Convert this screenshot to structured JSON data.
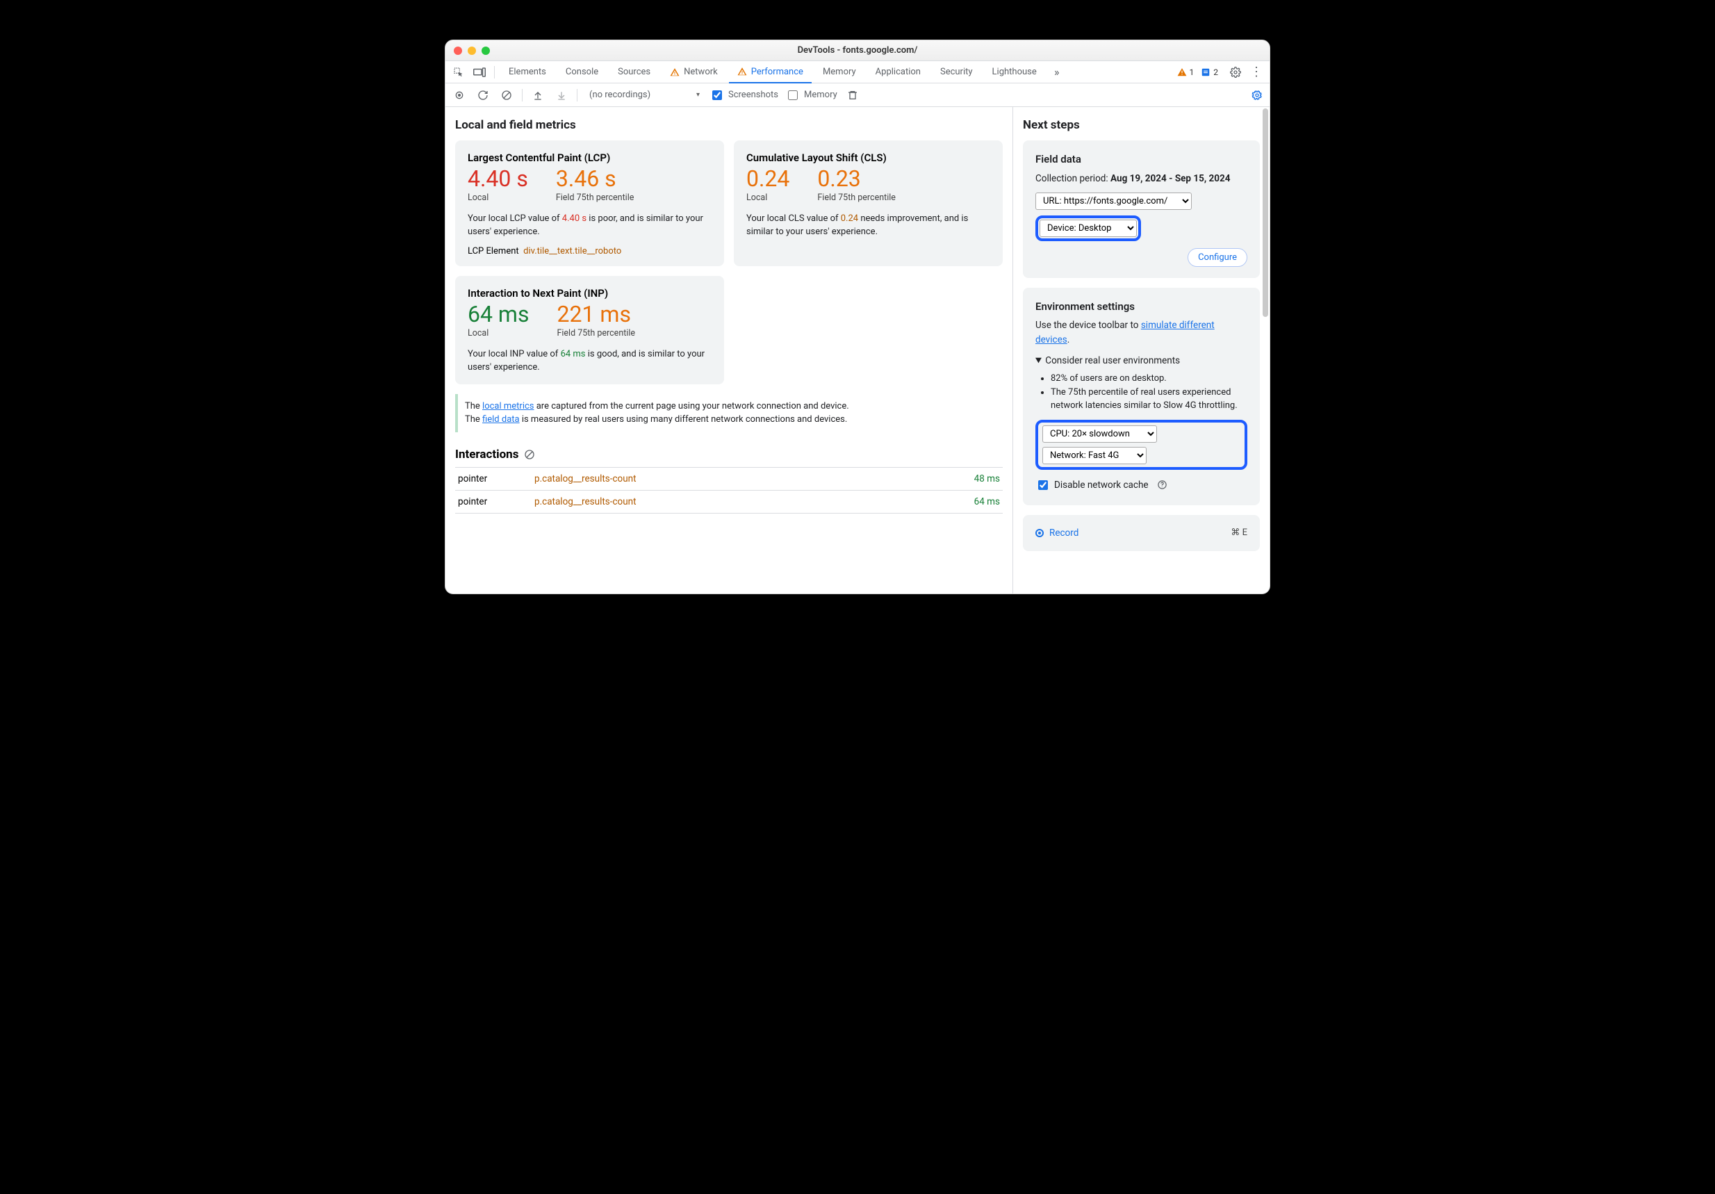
{
  "window": {
    "title": "DevTools - fonts.google.com/"
  },
  "tabs": {
    "items": [
      "Elements",
      "Console",
      "Sources",
      "Network",
      "Performance",
      "Memory",
      "Application",
      "Security",
      "Lighthouse"
    ],
    "active_index": 4,
    "warn_tabs": [
      3,
      4
    ],
    "warn_count": "1",
    "info_count": "2"
  },
  "toolbar": {
    "recordings_placeholder": "(no recordings)",
    "screenshots_label": "Screenshots",
    "memory_label": "Memory"
  },
  "left": {
    "section_title": "Local and field metrics",
    "lcp": {
      "title": "Largest Contentful Paint (LCP)",
      "local_value": "4.40 s",
      "local_label": "Local",
      "field_value": "3.46 s",
      "field_label": "Field 75th percentile",
      "desc_pre": "Your local LCP value of ",
      "desc_val": "4.40 s",
      "desc_post": " is poor, and is similar to your users' experience.",
      "el_label": "LCP Element",
      "el_sel": "div.tile__text.tile__roboto"
    },
    "cls": {
      "title": "Cumulative Layout Shift (CLS)",
      "local_value": "0.24",
      "local_label": "Local",
      "field_value": "0.23",
      "field_label": "Field 75th percentile",
      "desc_pre": "Your local CLS value of ",
      "desc_val": "0.24",
      "desc_post": " needs improvement, and is similar to your users' experience."
    },
    "inp": {
      "title": "Interaction to Next Paint (INP)",
      "local_value": "64 ms",
      "local_label": "Local",
      "field_value": "221 ms",
      "field_label": "Field 75th percentile",
      "desc_pre": "Your local INP value of ",
      "desc_val": "64 ms",
      "desc_post": " is good, and is similar to your users' experience."
    },
    "note": {
      "pre1": "The ",
      "link1": "local metrics",
      "mid1": " are captured from the current page using your network connection and device.",
      "pre2": "The ",
      "link2": "field data",
      "mid2": " is measured by real users using many different network connections and devices."
    },
    "interactions": {
      "title": "Interactions",
      "rows": [
        {
          "kind": "pointer",
          "selector": "p.catalog__results-count",
          "time": "48 ms"
        },
        {
          "kind": "pointer",
          "selector": "p.catalog__results-count",
          "time": "64 ms"
        }
      ]
    }
  },
  "right": {
    "title": "Next steps",
    "field": {
      "heading": "Field data",
      "period_label": "Collection period: ",
      "period_value": "Aug 19, 2024 - Sep 15, 2024",
      "url_select": "URL: https://fonts.google.com/",
      "device_select": "Device: Desktop",
      "configure": "Configure"
    },
    "env": {
      "heading": "Environment settings",
      "tip_pre": "Use the device toolbar to ",
      "tip_link": "simulate different devices",
      "tip_post": ".",
      "details_summary": "Consider real user environments",
      "bullets": [
        "82% of users are on desktop.",
        "The 75th percentile of real users experienced network latencies similar to Slow 4G throttling."
      ],
      "cpu_select": "CPU: 20× slowdown",
      "net_select": "Network: Fast 4G",
      "cache_label": "Disable network cache"
    },
    "record": {
      "label": "Record",
      "shortcut": "⌘ E"
    }
  }
}
